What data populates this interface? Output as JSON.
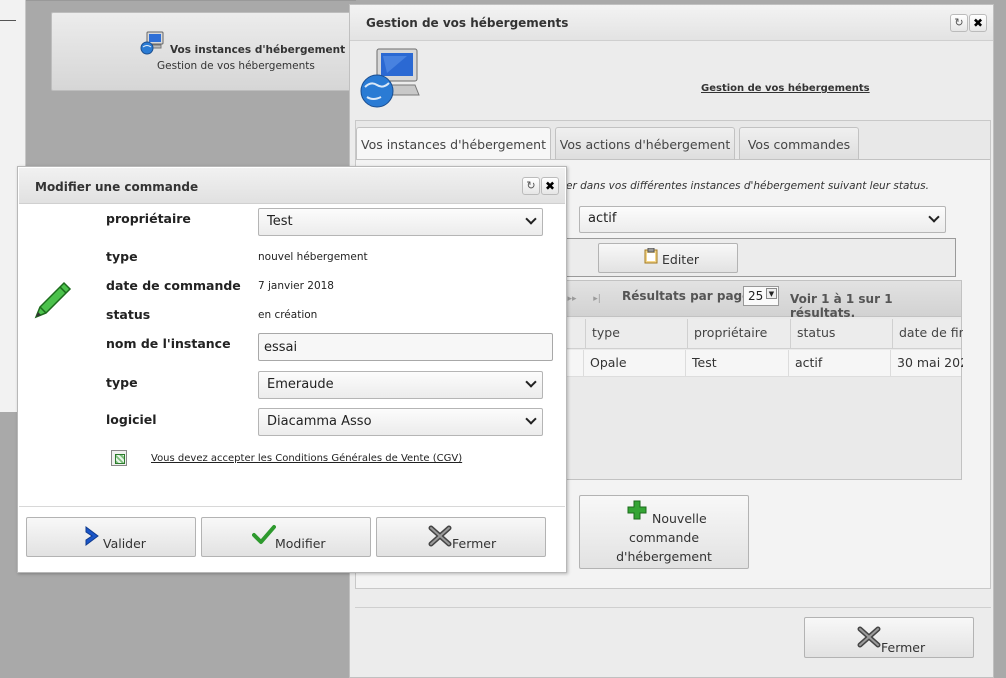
{
  "menu_tile": {
    "title": "Vos instances d'hébergement",
    "subtitle": "Gestion de vos hébergements"
  },
  "host_window": {
    "title": "Gestion de vos hébergements",
    "header_link": "Gestion de vos hébergements",
    "tabs": [
      {
        "label": "Vos instances d'hébergement",
        "active": true
      },
      {
        "label": "Vos actions d'hébergement",
        "active": false
      },
      {
        "label": "Vos commandes",
        "active": false
      }
    ],
    "filter_text": "er dans vos différentes instances d'hébergement suivant leur status.",
    "status_filter": "actif",
    "edit_button": "Editer",
    "pager": {
      "per_page_label": "Résultats par page:",
      "per_page_value": "25",
      "results": "Voir 1 à 1 sur 1 résultats."
    },
    "columns": [
      "type",
      "propriétaire",
      "status",
      "date de fin"
    ],
    "rows": [
      {
        "type": "Opale",
        "owner": "Test",
        "status": "actif",
        "end_date": "30 mai 202"
      }
    ],
    "new_order_button": [
      "Nouvelle",
      "commande",
      "d'hébergement"
    ],
    "close_button": "Fermer"
  },
  "modal": {
    "title": "Modifier une commande",
    "fields": {
      "owner_label": "propriétaire",
      "owner_value": "Test",
      "type_label": "type",
      "type_value": "nouvel hébergement",
      "date_label": "date de commande",
      "date_value": "7 janvier 2018",
      "status_label": "status",
      "status_value": "en création",
      "instance_label": "nom de l'instance",
      "instance_value": "essai",
      "type2_label": "type",
      "type2_value": "Emeraude",
      "software_label": "logiciel",
      "software_value": "Diacamma Asso"
    },
    "cgv_text": "Vous devez accepter les Conditions Générales de Vente (CGV)",
    "buttons": {
      "validate": "Valider",
      "modify": "Modifier",
      "close": "Fermer"
    }
  },
  "colors": {
    "overlay": "#a9a9a9",
    "window_bg": "#ececec",
    "valider_icon": "#1a55c8",
    "modifier_icon": "#2e9a2e",
    "plus_icon": "#2e9a2e"
  }
}
